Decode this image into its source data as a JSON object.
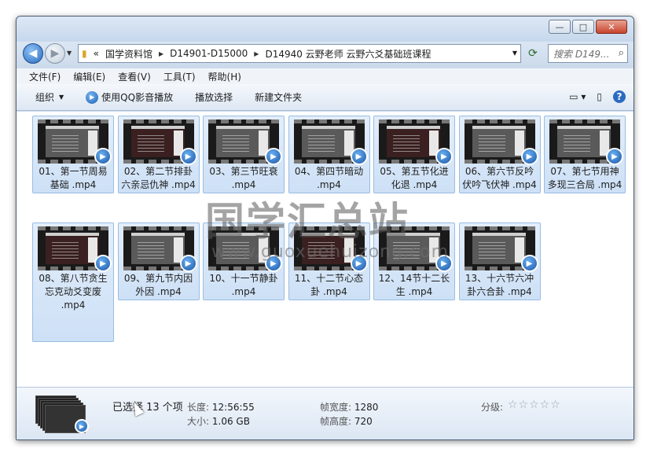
{
  "window": {
    "controls": {
      "minimize": "—",
      "maximize": "□",
      "close": "✕"
    }
  },
  "navbar": {
    "history_marker": "«",
    "breadcrumbs": [
      "国学资料馆",
      "D14901-D15000",
      "D14940 云野老师 云野六爻基础班课程"
    ],
    "search_placeholder": "搜索 D149..."
  },
  "menubar": {
    "items": [
      "文件(F)",
      "编辑(E)",
      "查看(V)",
      "工具(T)",
      "帮助(H)"
    ]
  },
  "toolbar": {
    "organize": "组织",
    "qq_play": "使用QQ影音播放",
    "play_selection": "播放选择",
    "new_folder": "新建文件夹",
    "icons": [
      "view-icon",
      "preview-pane-icon",
      "help-icon"
    ]
  },
  "files": [
    {
      "line1": "01、第一节周易",
      "line2": "基础 .mp4",
      "line3": ""
    },
    {
      "line1": "02、第二节排卦",
      "line2": "六亲忌仇神 .mp4",
      "line3": ""
    },
    {
      "line1": "03、第三节旺衰",
      "line2": ".mp4",
      "line3": ""
    },
    {
      "line1": "04、第四节暗动",
      "line2": ".mp4",
      "line3": ""
    },
    {
      "line1": "05、第五节化进",
      "line2": "化退 .mp4",
      "line3": ""
    },
    {
      "line1": "06、第六节反吟",
      "line2": "伏吟飞伏神 .mp4",
      "line3": ""
    },
    {
      "line1": "07、第七节用神",
      "line2": "多现三合局 .mp4",
      "line3": ""
    },
    {
      "line1": "08、第八节贪生",
      "line2": "忘克动爻变废",
      "line3": ".mp4"
    },
    {
      "line1": "09、第九节内因",
      "line2": "外因 .mp4",
      "line3": ""
    },
    {
      "line1": "10、十一节静卦",
      "line2": ".mp4",
      "line3": ""
    },
    {
      "line1": "11、十二节心态",
      "line2": "卦 .mp4",
      "line3": ""
    },
    {
      "line1": "12、14节十二长",
      "line2": "生 .mp4",
      "line3": ""
    },
    {
      "line1": "13、十六节六冲",
      "line2": "卦六合卦 .mp4",
      "line3": ""
    }
  ],
  "watermark": {
    "main": "国学汇总站",
    "url": "www.guoxuehuizong.com"
  },
  "details": {
    "selected": "已选择 13 个项",
    "length_label": "长度:",
    "length_value": "12:56:55",
    "size_label": "大小:",
    "size_value": "1.06 GB",
    "frame_width_label": "帧宽度:",
    "frame_width_value": "1280",
    "frame_height_label": "帧高度:",
    "frame_height_value": "720",
    "rating_label": "分级:",
    "rating_stars": "☆☆☆☆☆"
  },
  "colors": {
    "selection_bg": "#cde0f6",
    "selection_border": "#99bde3",
    "accent": "#2b6cc0"
  }
}
